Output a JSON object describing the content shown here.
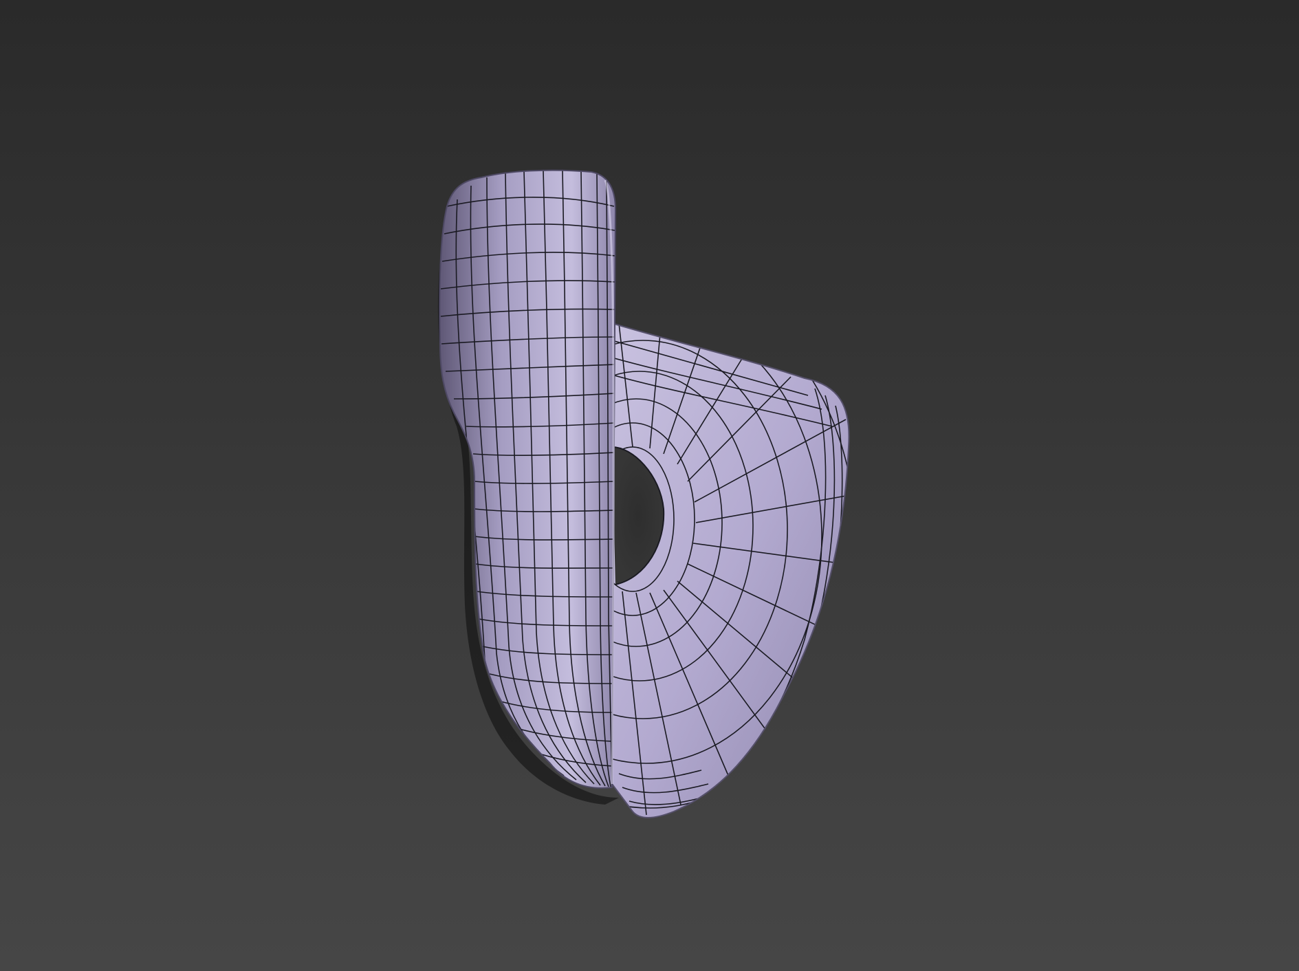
{
  "viewport": {
    "background_top": "#2a2a2a",
    "background_bottom": "#464646",
    "render_mode": "shaded-wireframe",
    "object": {
      "name": "lavender-mesh-object",
      "surface_color": "#b2a9cf",
      "surface_highlight": "#d6d0ea",
      "surface_shadow": "#6f6888",
      "wire_color": "#1a1a22"
    }
  }
}
